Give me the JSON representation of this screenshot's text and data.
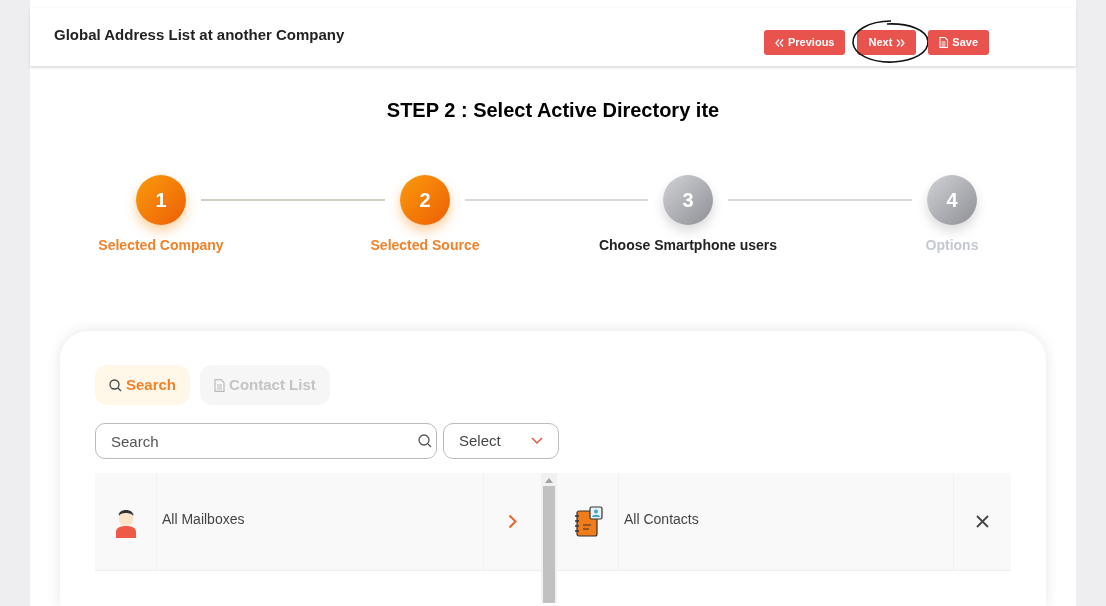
{
  "header": {
    "title": "Global Address List at another Company",
    "buttons": [
      {
        "label": "Previous",
        "kind": "previous",
        "highlighted": false
      },
      {
        "label": "Next",
        "kind": "next",
        "highlighted": true
      },
      {
        "label": "Save",
        "kind": "save",
        "highlighted": false
      }
    ]
  },
  "step_title": "STEP 2 : Select Active Directory ite",
  "steps": [
    {
      "number": "1",
      "label": "Selected Company",
      "done": true,
      "current": false
    },
    {
      "number": "2",
      "label": "Selected Source",
      "done": true,
      "current": false
    },
    {
      "number": "3",
      "label": "Choose Smartphone users",
      "done": false,
      "current": true
    },
    {
      "number": "4",
      "label": "Options",
      "done": false,
      "current": false
    }
  ],
  "tabs": [
    {
      "label": "Search",
      "kind": "search",
      "selected": true
    },
    {
      "label": "Contact List",
      "kind": "list",
      "selected": false
    }
  ],
  "search": {
    "placeholder": "Search"
  },
  "select": {
    "value": "Select"
  },
  "available": [
    {
      "label": "All Mailboxes",
      "kind": "person"
    }
  ],
  "chosen": [
    {
      "label": "All Contacts",
      "kind": "contacts"
    }
  ]
}
